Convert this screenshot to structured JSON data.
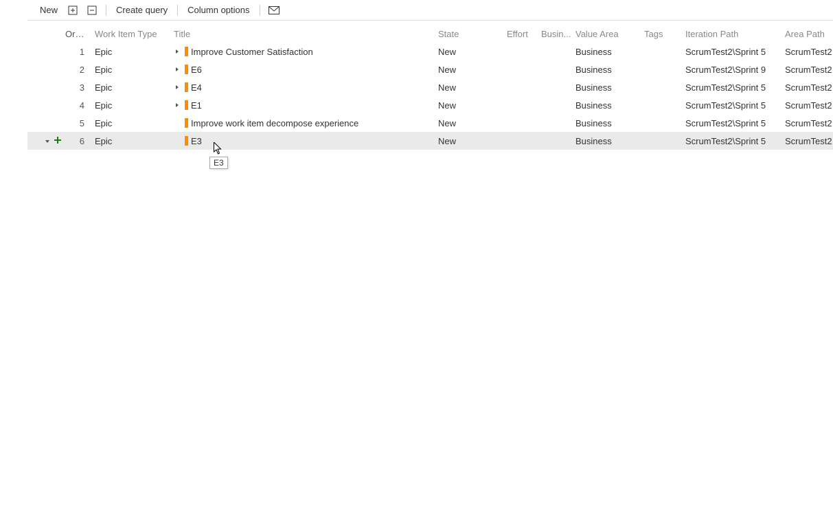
{
  "toolbar": {
    "new_label": "New",
    "create_query_label": "Create query",
    "column_options_label": "Column options"
  },
  "columns": {
    "order": "Order",
    "work_item_type": "Work Item Type",
    "title": "Title",
    "state": "State",
    "effort": "Effort",
    "busin": "Busin...",
    "value_area": "Value Area",
    "tags": "Tags",
    "iteration_path": "Iteration Path",
    "area_path": "Area Path"
  },
  "rows": [
    {
      "order": "1",
      "type": "Epic",
      "title": "Improve Customer Satisfaction",
      "state": "New",
      "value_area": "Business",
      "iteration": "ScrumTest2\\Sprint 5",
      "area": "ScrumTest2",
      "has_children": true,
      "selected": false
    },
    {
      "order": "2",
      "type": "Epic",
      "title": "E6",
      "state": "New",
      "value_area": "Business",
      "iteration": "ScrumTest2\\Sprint 9",
      "area": "ScrumTest2",
      "has_children": true,
      "selected": false
    },
    {
      "order": "3",
      "type": "Epic",
      "title": "E4",
      "state": "New",
      "value_area": "Business",
      "iteration": "ScrumTest2\\Sprint 5",
      "area": "ScrumTest2",
      "has_children": true,
      "selected": false
    },
    {
      "order": "4",
      "type": "Epic",
      "title": "E1",
      "state": "New",
      "value_area": "Business",
      "iteration": "ScrumTest2\\Sprint 5",
      "area": "ScrumTest2",
      "has_children": true,
      "selected": false
    },
    {
      "order": "5",
      "type": "Epic",
      "title": "Improve work item decompose experience",
      "state": "New",
      "value_area": "Business",
      "iteration": "ScrumTest2\\Sprint 5",
      "area": "ScrumTest2",
      "has_children": false,
      "selected": false
    },
    {
      "order": "6",
      "type": "Epic",
      "title": "E3",
      "state": "New",
      "value_area": "Business",
      "iteration": "ScrumTest2\\Sprint 5",
      "area": "ScrumTest2",
      "has_children": false,
      "selected": true
    }
  ],
  "tooltip_text": "E3",
  "colors": {
    "epic_bar": "#ff8c00",
    "add_green": "#107c10"
  }
}
